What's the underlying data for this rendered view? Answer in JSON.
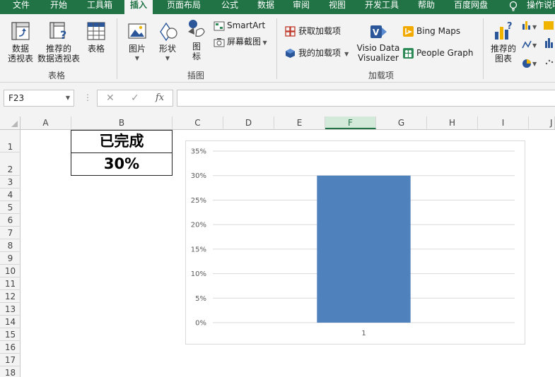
{
  "tabs": [
    {
      "label": "文件"
    },
    {
      "label": "开始"
    },
    {
      "label": "工具箱"
    },
    {
      "label": "插入"
    },
    {
      "label": "页面布局"
    },
    {
      "label": "公式"
    },
    {
      "label": "数据"
    },
    {
      "label": "审阅"
    },
    {
      "label": "视图"
    },
    {
      "label": "开发工具"
    },
    {
      "label": "帮助"
    },
    {
      "label": "百度网盘"
    },
    {
      "label": "操作说明"
    }
  ],
  "active_tab": "插入",
  "ribbon": {
    "tables_group": {
      "label": "表格",
      "pivot_table": [
        "数据",
        "透视表"
      ],
      "recommended_pivot": [
        "推荐的",
        "数据透视表"
      ],
      "table": "表格"
    },
    "illustrations_group": {
      "label": "插图",
      "pictures": "图片",
      "shapes": "形状",
      "icons": [
        "图",
        "标"
      ],
      "smartart": "SmartArt",
      "screenshot": "屏幕截图"
    },
    "addins_group": {
      "label": "加载项",
      "get_addins": "获取加载项",
      "my_addins": "我的加载项",
      "visio": [
        "Visio Data",
        "Visualizer"
      ],
      "bing_maps": "Bing Maps",
      "people_graph": "People Graph"
    },
    "charts_group": {
      "recommended_charts": [
        "推荐的",
        "图表"
      ]
    }
  },
  "formula_bar": {
    "name_box": "F23",
    "cancel": "✕",
    "enter": "✓",
    "fx": "fx",
    "formula": ""
  },
  "grid": {
    "columns": [
      "A",
      "B",
      "C",
      "D",
      "E",
      "F",
      "G",
      "H",
      "I",
      "J"
    ],
    "selected_column": "F",
    "rows": [
      "1",
      "2",
      "3",
      "4",
      "5",
      "6",
      "7",
      "8",
      "9",
      "10",
      "11",
      "12",
      "13",
      "14",
      "15",
      "16",
      "17",
      "18"
    ],
    "cells": {
      "B1": "已完成",
      "B2": "30%"
    }
  },
  "chart_data": {
    "type": "bar",
    "categories": [
      "1"
    ],
    "values": [
      0.3
    ],
    "yticks": [
      "0%",
      "5%",
      "10%",
      "15%",
      "20%",
      "25%",
      "30%",
      "35%"
    ],
    "ylim": [
      0,
      0.35
    ],
    "grid": true,
    "bar_color": "#4f81bd",
    "title": "",
    "xlabel": "",
    "ylabel": ""
  },
  "colors": {
    "excel_green": "#217346",
    "ribbon_bg": "#f3f3f3",
    "bar_blue": "#4f81bd"
  }
}
